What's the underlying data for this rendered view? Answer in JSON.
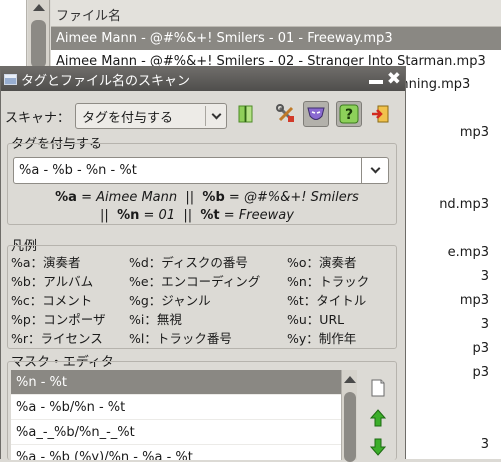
{
  "main_window": {
    "file_column_header": "ファイル名",
    "files": [
      "Aimee Mann - @#%&+! Smilers - 01 - Freeway.mp3",
      "Aimee Mann - @#%&+! Smilers - 02 - Stranger Into Starman.mp3",
      "Aimee Mann - @#%&+! Smilers - 03 - Looking for Sunning.mp3"
    ],
    "visible_fragments": [
      "mp3",
      "nd.mp3",
      "e.mp3",
      "3",
      "mp3",
      "3",
      "p3",
      "p3",
      "3"
    ]
  },
  "dialog": {
    "title": "タグとファイル名のスキャン",
    "scanner_label": "スキャナ：",
    "scanner_value": "タグを付与する",
    "tag_section_title": "タグを付与する",
    "format_value": "%a - %b - %n - %t",
    "preview": {
      "a_code": "%a",
      "a_value": "Aimee Mann",
      "b_code": "%b",
      "b_value": "@#%&+! Smilers",
      "n_code": "%n",
      "n_value": "01",
      "t_code": "%t",
      "t_value": "Freeway",
      "sep": "||",
      "eq": "="
    },
    "legend_title": "凡例",
    "legend": [
      "%a：演奏者",
      "%d：ディスクの番号",
      "%o：演奏者",
      "%b：アルバム",
      "%e：エンコーディング",
      "%n：トラック",
      "%c：コメント",
      "%g：ジャンル",
      "%t：タイトル",
      "%p：コンポーザ",
      "%i：無視",
      "%u：URL",
      "%r：ライセンス",
      "%l：トラック番号",
      "%y：制作年"
    ],
    "mask_editor_title": "マスク・エディタ",
    "masks": [
      "%n - %t",
      "%a - %b/%n - %t",
      "%a_-_%b/%n_-_%t",
      "%a - %b (%y)/%n - %a - %t"
    ]
  }
}
